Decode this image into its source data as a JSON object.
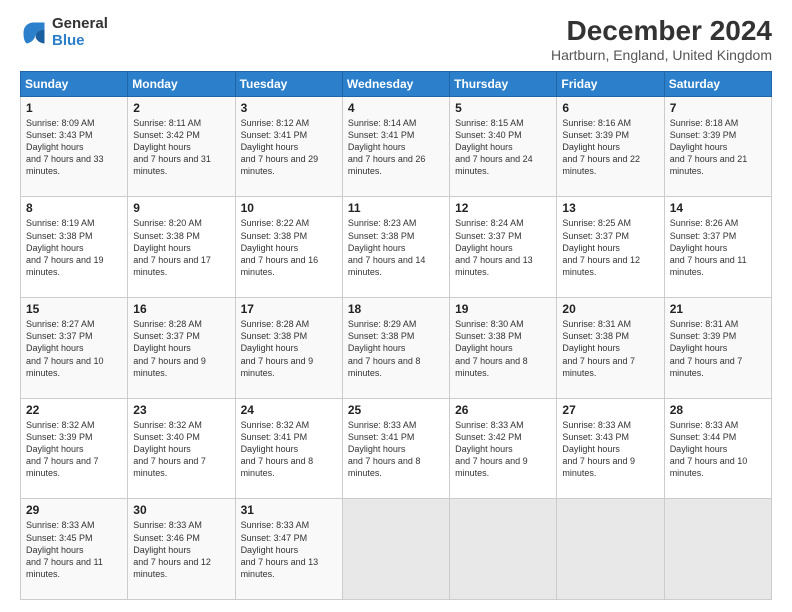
{
  "logo": {
    "general": "General",
    "blue": "Blue"
  },
  "title": "December 2024",
  "subtitle": "Hartburn, England, United Kingdom",
  "headers": [
    "Sunday",
    "Monday",
    "Tuesday",
    "Wednesday",
    "Thursday",
    "Friday",
    "Saturday"
  ],
  "weeks": [
    [
      {
        "day": "1",
        "rise": "8:09 AM",
        "set": "3:43 PM",
        "daylight": "7 hours and 33 minutes."
      },
      {
        "day": "2",
        "rise": "8:11 AM",
        "set": "3:42 PM",
        "daylight": "7 hours and 31 minutes."
      },
      {
        "day": "3",
        "rise": "8:12 AM",
        "set": "3:41 PM",
        "daylight": "7 hours and 29 minutes."
      },
      {
        "day": "4",
        "rise": "8:14 AM",
        "set": "3:41 PM",
        "daylight": "7 hours and 26 minutes."
      },
      {
        "day": "5",
        "rise": "8:15 AM",
        "set": "3:40 PM",
        "daylight": "7 hours and 24 minutes."
      },
      {
        "day": "6",
        "rise": "8:16 AM",
        "set": "3:39 PM",
        "daylight": "7 hours and 22 minutes."
      },
      {
        "day": "7",
        "rise": "8:18 AM",
        "set": "3:39 PM",
        "daylight": "7 hours and 21 minutes."
      }
    ],
    [
      {
        "day": "8",
        "rise": "8:19 AM",
        "set": "3:38 PM",
        "daylight": "7 hours and 19 minutes."
      },
      {
        "day": "9",
        "rise": "8:20 AM",
        "set": "3:38 PM",
        "daylight": "7 hours and 17 minutes."
      },
      {
        "day": "10",
        "rise": "8:22 AM",
        "set": "3:38 PM",
        "daylight": "7 hours and 16 minutes."
      },
      {
        "day": "11",
        "rise": "8:23 AM",
        "set": "3:38 PM",
        "daylight": "7 hours and 14 minutes."
      },
      {
        "day": "12",
        "rise": "8:24 AM",
        "set": "3:37 PM",
        "daylight": "7 hours and 13 minutes."
      },
      {
        "day": "13",
        "rise": "8:25 AM",
        "set": "3:37 PM",
        "daylight": "7 hours and 12 minutes."
      },
      {
        "day": "14",
        "rise": "8:26 AM",
        "set": "3:37 PM",
        "daylight": "7 hours and 11 minutes."
      }
    ],
    [
      {
        "day": "15",
        "rise": "8:27 AM",
        "set": "3:37 PM",
        "daylight": "7 hours and 10 minutes."
      },
      {
        "day": "16",
        "rise": "8:28 AM",
        "set": "3:37 PM",
        "daylight": "7 hours and 9 minutes."
      },
      {
        "day": "17",
        "rise": "8:28 AM",
        "set": "3:38 PM",
        "daylight": "7 hours and 9 minutes."
      },
      {
        "day": "18",
        "rise": "8:29 AM",
        "set": "3:38 PM",
        "daylight": "7 hours and 8 minutes."
      },
      {
        "day": "19",
        "rise": "8:30 AM",
        "set": "3:38 PM",
        "daylight": "7 hours and 8 minutes."
      },
      {
        "day": "20",
        "rise": "8:31 AM",
        "set": "3:38 PM",
        "daylight": "7 hours and 7 minutes."
      },
      {
        "day": "21",
        "rise": "8:31 AM",
        "set": "3:39 PM",
        "daylight": "7 hours and 7 minutes."
      }
    ],
    [
      {
        "day": "22",
        "rise": "8:32 AM",
        "set": "3:39 PM",
        "daylight": "7 hours and 7 minutes."
      },
      {
        "day": "23",
        "rise": "8:32 AM",
        "set": "3:40 PM",
        "daylight": "7 hours and 7 minutes."
      },
      {
        "day": "24",
        "rise": "8:32 AM",
        "set": "3:41 PM",
        "daylight": "7 hours and 8 minutes."
      },
      {
        "day": "25",
        "rise": "8:33 AM",
        "set": "3:41 PM",
        "daylight": "7 hours and 8 minutes."
      },
      {
        "day": "26",
        "rise": "8:33 AM",
        "set": "3:42 PM",
        "daylight": "7 hours and 9 minutes."
      },
      {
        "day": "27",
        "rise": "8:33 AM",
        "set": "3:43 PM",
        "daylight": "7 hours and 9 minutes."
      },
      {
        "day": "28",
        "rise": "8:33 AM",
        "set": "3:44 PM",
        "daylight": "7 hours and 10 minutes."
      }
    ],
    [
      {
        "day": "29",
        "rise": "8:33 AM",
        "set": "3:45 PM",
        "daylight": "7 hours and 11 minutes."
      },
      {
        "day": "30",
        "rise": "8:33 AM",
        "set": "3:46 PM",
        "daylight": "7 hours and 12 minutes."
      },
      {
        "day": "31",
        "rise": "8:33 AM",
        "set": "3:47 PM",
        "daylight": "7 hours and 13 minutes."
      },
      null,
      null,
      null,
      null
    ]
  ]
}
